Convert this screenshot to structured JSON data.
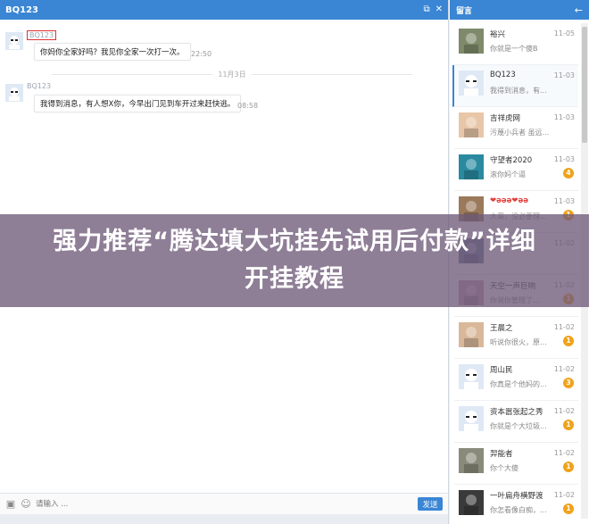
{
  "chat": {
    "title": "BQ123",
    "messages": [
      {
        "sender": "BQ123",
        "text": "你妈你全家好吗？我见你全家一次打一次。",
        "time": "22:50"
      },
      {
        "sender": "BQ123",
        "text": "我得到消息，有人想X你，今早出门见到车开过来赶快逃。",
        "time": "08:58"
      }
    ],
    "date_separator": "11月3日",
    "input_placeholder": "请输入 ...",
    "send_label": "发送"
  },
  "panel": {
    "title": "留言",
    "contacts": [
      {
        "name": "裕兴",
        "date": "11-05",
        "preview": "你就是一个傻B",
        "badge": ""
      },
      {
        "name": "BQ123",
        "date": "11-03",
        "preview": "我得到消息，有...",
        "badge": ""
      },
      {
        "name": "吉祥虎网",
        "date": "11-03",
        "preview": "污蔑小兵者 虽远...",
        "badge": ""
      },
      {
        "name": "守望者2020",
        "date": "11-03",
        "preview": "滚你妈个逼",
        "badge": "4"
      },
      {
        "name": "❤ǝǝǝ❤ǝǝ",
        "date": "11-03",
        "preview": "大哥，没必要理...",
        "badge": "1"
      },
      {
        "name": "",
        "date": "11-02",
        "preview": "",
        "badge": ""
      },
      {
        "name": "天空一声巨响",
        "date": "11-02",
        "preview": "你说你管理了...",
        "badge": "1"
      },
      {
        "name": "王晨之",
        "date": "11-02",
        "preview": "听说你很火，原...",
        "badge": "1"
      },
      {
        "name": "周山民",
        "date": "11-02",
        "preview": "你真是个他妈的...",
        "badge": "3"
      },
      {
        "name": "资本嚣张起之秀",
        "date": "11-02",
        "preview": "你就是个大垃圾...",
        "badge": "1"
      },
      {
        "name": "羿能者",
        "date": "11-02",
        "preview": "你个大傻",
        "badge": "1"
      },
      {
        "name": "一叶扁舟横野渡",
        "date": "11-02",
        "preview": "你怎看像白痴，...",
        "badge": "1"
      }
    ]
  },
  "overlay": {
    "text": "强力推荐“腾达填大坑挂先试用后付款”详细开挂教程"
  },
  "colors": {
    "accent": "#3a86d4",
    "badge": "#f0a21b",
    "highlight_box": "#dd3333"
  }
}
